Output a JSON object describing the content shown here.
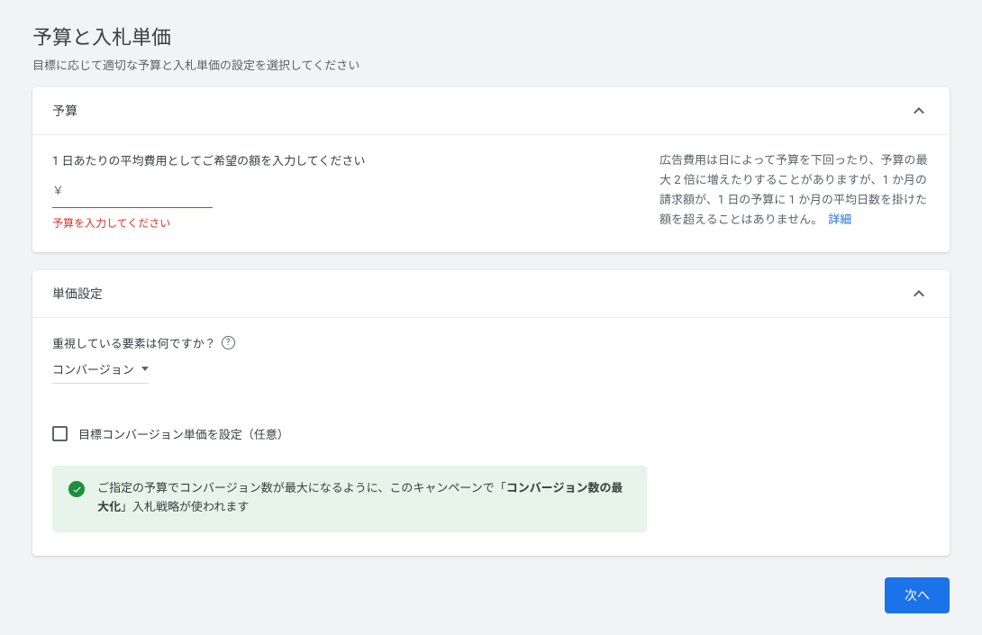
{
  "page": {
    "title": "予算と入札単価",
    "subtitle": "目標に応じて適切な予算と入札単価の設定を選択してください"
  },
  "budget_card": {
    "header": "予算",
    "field_label": "1 日あたりの平均費用としてご希望の額を入力してください",
    "currency_symbol": "￥",
    "error": "予算を入力してください",
    "info_text": "広告費用は日によって予算を下回ったり、予算の最大 2 倍に増えたりすることがありますが、1 か月の請求額が、1 日の予算に 1 か月の平均日数を掛けた額を超えることはありません。",
    "info_link": "詳細"
  },
  "bid_card": {
    "header": "単価設定",
    "focus_label": "重視している要素は何ですか？",
    "select_value": "コンバージョン",
    "checkbox_label": "目標コンバージョン単価を設定（任意）",
    "notice_prefix": "ご指定の予算でコンバージョン数が最大になるように、このキャンペーンで「",
    "notice_bold": "コンバージョン数の最大化",
    "notice_suffix": "」入札戦略が使われます"
  },
  "footer": {
    "next": "次へ"
  }
}
